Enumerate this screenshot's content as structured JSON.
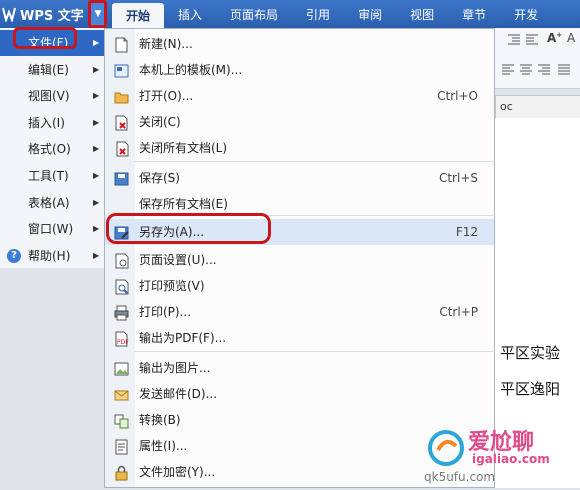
{
  "app": {
    "title": "WPS 文字"
  },
  "ribbon_tabs": [
    {
      "label": "开始",
      "active": true
    },
    {
      "label": "插入"
    },
    {
      "label": "页面布局"
    },
    {
      "label": "引用"
    },
    {
      "label": "审阅"
    },
    {
      "label": "视图"
    },
    {
      "label": "章节"
    },
    {
      "label": "开发"
    }
  ],
  "left_menu": [
    {
      "label": "文件(F)",
      "active": true
    },
    {
      "label": "编辑(E)"
    },
    {
      "label": "视图(V)"
    },
    {
      "label": "插入(I)"
    },
    {
      "label": "格式(O)"
    },
    {
      "label": "工具(T)"
    },
    {
      "label": "表格(A)"
    },
    {
      "label": "窗口(W)"
    },
    {
      "label": "帮助(H)"
    }
  ],
  "file_menu": [
    {
      "label": "新建(N)...",
      "shortcut": "",
      "icon": "new-document-icon"
    },
    {
      "label": "本机上的模板(M)...",
      "shortcut": "",
      "icon": "template-icon"
    },
    {
      "label": "打开(O)...",
      "shortcut": "Ctrl+O",
      "icon": "open-folder-icon"
    },
    {
      "label": "关闭(C)",
      "shortcut": "",
      "icon": "close-document-icon"
    },
    {
      "label": "关闭所有文档(L)",
      "shortcut": "",
      "icon": "close-all-icon"
    },
    {
      "label": "保存(S)",
      "shortcut": "Ctrl+S",
      "icon": "save-icon"
    },
    {
      "label": "保存所有文档(E)",
      "shortcut": "",
      "icon": ""
    },
    {
      "label": "另存为(A)...",
      "shortcut": "F12",
      "icon": "save-as-icon",
      "highlighted": true
    },
    {
      "label": "页面设置(U)...",
      "shortcut": "",
      "icon": "page-setup-icon"
    },
    {
      "label": "打印预览(V)",
      "shortcut": "",
      "icon": "print-preview-icon"
    },
    {
      "label": "打印(P)...",
      "shortcut": "Ctrl+P",
      "icon": "print-icon"
    },
    {
      "label": "输出为PDF(F)...",
      "shortcut": "",
      "icon": "pdf-icon"
    },
    {
      "label": "输出为图片...",
      "shortcut": "",
      "icon": "export-image-icon"
    },
    {
      "label": "发送邮件(D)...",
      "shortcut": "",
      "icon": "email-icon"
    },
    {
      "label": "转换(B)",
      "shortcut": "",
      "icon": "convert-icon"
    },
    {
      "label": "属性(I)...",
      "shortcut": "",
      "icon": "properties-icon"
    },
    {
      "label": "文件加密(Y)...",
      "shortcut": "",
      "icon": "encrypt-icon"
    }
  ],
  "document": {
    "tab_fragment": "oc",
    "lines": [
      "平区实验",
      "平区逸阳"
    ]
  },
  "watermark": {
    "brand": "爱尬聊",
    "domain": "igaliao.com",
    "sub": "qk5ufu.com"
  },
  "colors": {
    "title_bar": "#2a5fae",
    "menu_active": "#2f67c4",
    "annotation_red": "#c8161d",
    "hover": "#dbe6f7"
  }
}
